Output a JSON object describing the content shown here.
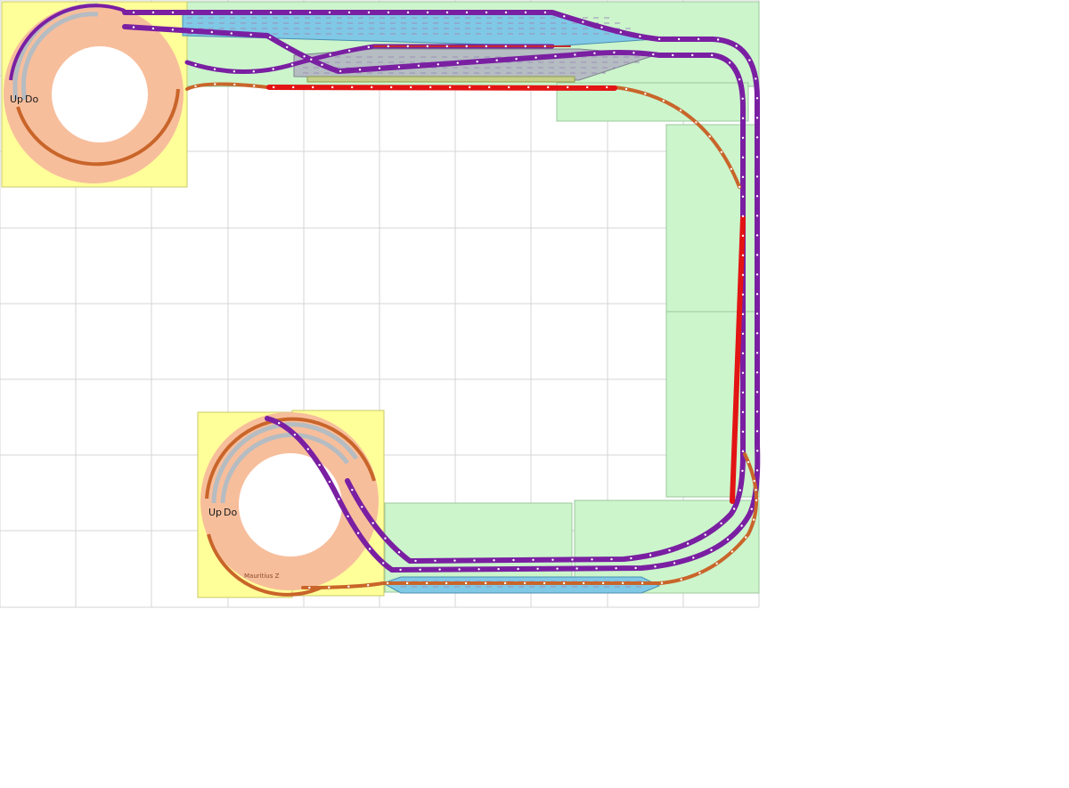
{
  "helix_labels": {
    "top_left_up": "Up",
    "top_left_down": "Do",
    "bottom_left_up": "Up",
    "bottom_left_down": "Do",
    "bottom_helix_name": "Mauritius Z"
  },
  "colors": {
    "background": "#ffffff",
    "grid_line": "#d4d4d4",
    "board_green": "#ccf5cc",
    "board_yellow": "#ffff99",
    "helix_fill": "#f7be9c",
    "mainline_purple": "#7a1fa2",
    "mainline_orange": "#c9652a",
    "siding_blue": "#7fc8e6",
    "siding_gray": "#b5bcc2",
    "siding_olive": "#c5d08a",
    "highlight_red": "#e31414"
  }
}
